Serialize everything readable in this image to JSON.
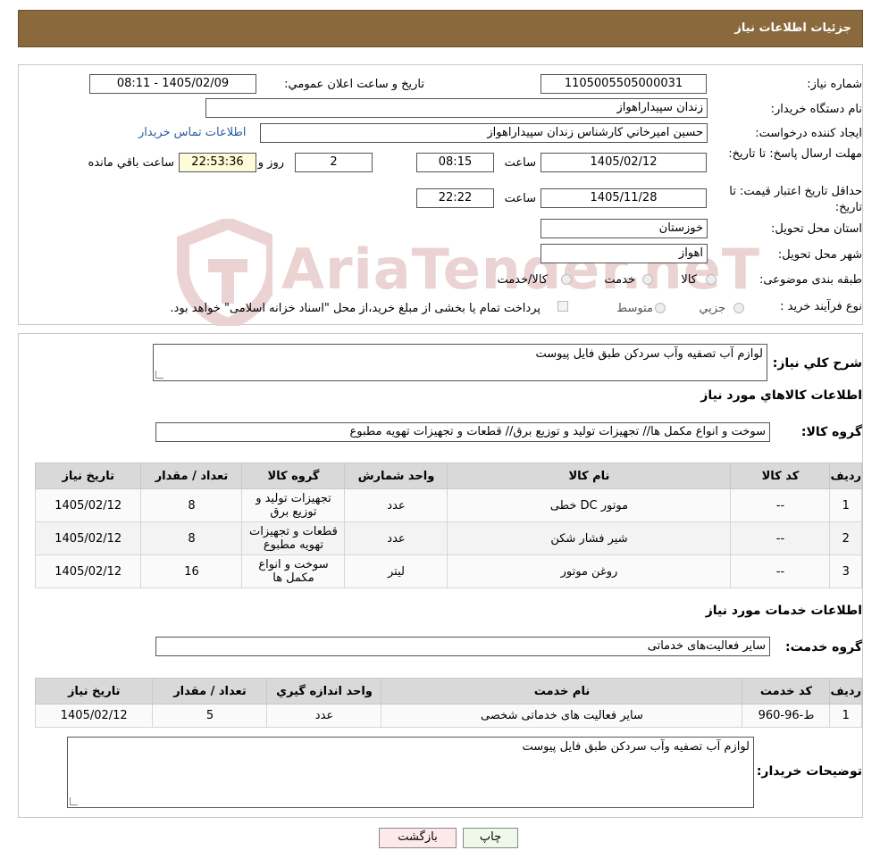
{
  "header": {
    "title": "جزئیات اطلاعات نیاز"
  },
  "watermark": {
    "text": "AriaTender.neT"
  },
  "info": {
    "need_number_label": "شماره نیاز:",
    "need_number": "1105005505000031",
    "announce_label": "تاریخ و ساعت اعلان عمومي:",
    "announce_value": "1405/02/09 - 08:11",
    "buyer_label": "نام دستگاه خريدار:",
    "buyer_value": "زندان سپيداراهواز",
    "creator_label": "ايجاد کننده درخواست:",
    "creator_value": "حسين اميرخاني کارشناس زندان سپيداراهواز",
    "contact_link": "اطلاعات تماس خريدار",
    "deadline_label": "مهلت ارسال پاسخ: تا تاريخ:",
    "deadline_date": "1405/02/12",
    "time_label": "ساعت",
    "deadline_time": "08:15",
    "days_value": "2",
    "days_label": "روز و",
    "remaining_value": "22:53:36",
    "remaining_label": "ساعت باقي مانده",
    "validity_label": "حداقل تاريخ اعتبار قيمت: تا تاريخ:",
    "validity_date": "1405/11/28",
    "validity_time": "22:22",
    "province_label": "استان محل تحويل:",
    "province_value": "خوزستان",
    "city_label": "شهر محل تحويل:",
    "city_value": "اهواز",
    "category_label": "طبقه بندی موضوعی:",
    "category_options": [
      "کالا",
      "خدمت",
      "کالا/خدمت"
    ],
    "process_label": "نوع فرآیند خرید :",
    "process_options": [
      "جزيي",
      "متوسط"
    ],
    "process_note": "پرداخت تمام یا بخشی از مبلغ خرید،از محل \"اسناد خزانه اسلامی\" خواهد بود."
  },
  "description": {
    "label": "شرح کلي نياز:",
    "value": "لوازم آب تصفیه وآب سردکن طبق فایل پیوست"
  },
  "goods": {
    "section_title": "اطلاعات کالاهاي مورد نياز",
    "group_label": "گروه کالا:",
    "group_value": "سوخت و انواع مکمل ها// تجهیزات تولید و توزیع برق//  قطعات و تجهیزات تهویه مطبوع",
    "columns": [
      "رديف",
      "کد کالا",
      "نام کالا",
      "واحد شمارش",
      "گروه کالا",
      "تعداد / مقدار",
      "تاريخ نياز"
    ],
    "rows": [
      {
        "row": "1",
        "code": "--",
        "name": "موتور DC خطی",
        "unit": "عدد",
        "group": "تجهیزات تولید و توزیع برق",
        "qty": "8",
        "date": "1405/02/12"
      },
      {
        "row": "2",
        "code": "--",
        "name": "شیر فشار شکن",
        "unit": "عدد",
        "group": "قطعات و تجهیزات تهویه مطبوع",
        "qty": "8",
        "date": "1405/02/12"
      },
      {
        "row": "3",
        "code": "--",
        "name": "روغن موتور",
        "unit": "لیتر",
        "group": "سوخت و انواع مکمل ها",
        "qty": "16",
        "date": "1405/02/12"
      }
    ]
  },
  "services": {
    "section_title": "اطلاعات خدمات مورد نياز",
    "group_label": "گروه خدمت:",
    "group_value": "سایر فعالیت‌های خدماتی",
    "columns": [
      "رديف",
      "کد خدمت",
      "نام خدمت",
      "واحد اندازه گيري",
      "تعداد / مقدار",
      "تاريخ نياز"
    ],
    "rows": [
      {
        "row": "1",
        "code": "ط-96-960",
        "name": "سایر فعالیت های خدماتی شخصی",
        "unit": "عدد",
        "qty": "5",
        "date": "1405/02/12"
      }
    ]
  },
  "buyer_notes": {
    "label": "توضيحات خريدار:",
    "value": "لوازم آب تصفیه وآب سردکن طبق فایل پیوست"
  },
  "buttons": {
    "print": "چاپ",
    "back": "بازگشت"
  }
}
